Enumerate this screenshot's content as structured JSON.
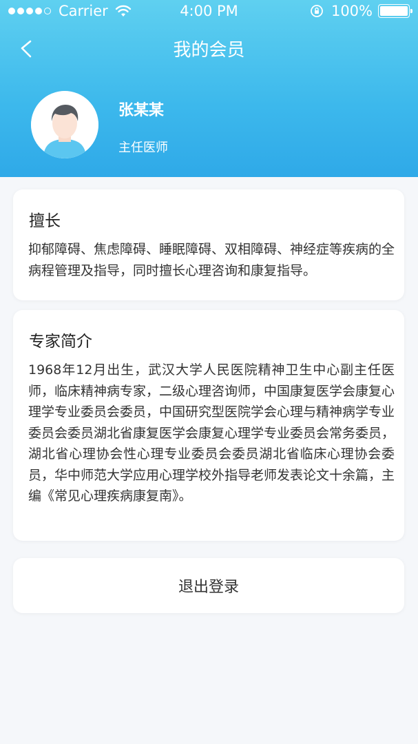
{
  "status_bar": {
    "carrier": "Carrier",
    "time": "4:00 PM",
    "battery": "100%",
    "signal_bars_filled": 4,
    "signal_bars_total": 5,
    "icons": [
      "signal-dots-icon",
      "wifi-icon",
      "rotation-lock-icon",
      "battery-icon"
    ]
  },
  "nav": {
    "title": "我的会员",
    "back_icon": "chevron-left-icon"
  },
  "profile": {
    "name": "张某某",
    "title": "主任医师",
    "avatar_icon": "avatar-icon"
  },
  "expertise": {
    "heading": "擅长",
    "text": "抑郁障碍、焦虑障碍、睡眠障碍、双相障碍、神经症等疾病的全病程管理及指导，同时擅长心理咨询和康复指导。"
  },
  "intro": {
    "heading": "专家简介",
    "text": "1968年12月出生，武汉大学人民医院精神卫生中心副主任医师，临床精神病专家，二级心理咨询师，中国康复医学会康复心理学专业委员会委员，中国研究型医院学会心理与精神病学专业委员会委员湖北省康复医学会康复心理学专业委员会常务委员，湖北省心理协会性心理专业委员会委员湖北省临床心理协会委员，华中师范大学应用心理学校外指导老师发表论文十余篇，主编《常见心理疾病康复南》。"
  },
  "logout": {
    "label": "退出登录"
  },
  "colors": {
    "header_top": "#5fd0f0",
    "header_bottom": "#2fa9e8",
    "page_bg": "#f5f7fa",
    "card_bg": "#ffffff"
  }
}
